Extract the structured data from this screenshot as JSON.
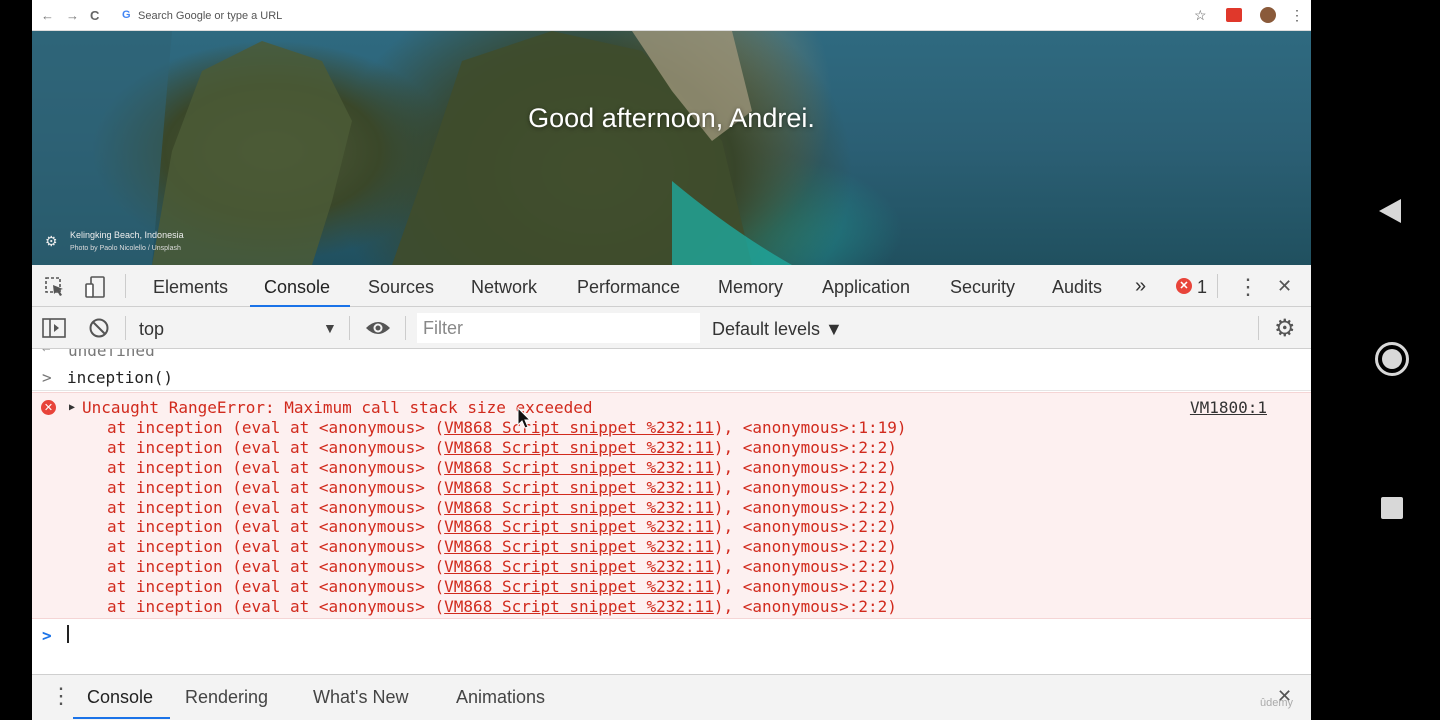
{
  "browser": {
    "omnibox_placeholder": "Search Google or type a URL",
    "back_icon": "←",
    "forward_icon": "→",
    "reload_icon": "C",
    "google_icon": "G",
    "star_icon": "☆",
    "menu_icon": "⋮"
  },
  "hero": {
    "greeting": "Good afternoon, Andrei.",
    "location": "Kelingking Beach, Indonesia",
    "credit": "Photo by Paolo Nicolello / Unsplash"
  },
  "devtools": {
    "tabs": [
      "Elements",
      "Console",
      "Sources",
      "Network",
      "Performance",
      "Memory",
      "Application",
      "Security",
      "Audits"
    ],
    "more_tabs": "»",
    "error_count": "1",
    "close": "✕",
    "context": "top",
    "filter_placeholder": "Filter",
    "levels": "Default levels ▼"
  },
  "console": {
    "previous_result": "undefined",
    "input_prompt": ">",
    "input": "inception()",
    "error": {
      "message": "Uncaught RangeError: Maximum call stack size exceeded",
      "source": "VM1800:1",
      "frames": [
        {
          "prefix": "at inception (eval at <anonymous> (",
          "link": "VM868 Script snippet %232:11",
          "suffix": "), <anonymous>:1:19)"
        },
        {
          "prefix": "at inception (eval at <anonymous> (",
          "link": "VM868 Script snippet %232:11",
          "suffix": "), <anonymous>:2:2)"
        },
        {
          "prefix": "at inception (eval at <anonymous> (",
          "link": "VM868 Script snippet %232:11",
          "suffix": "), <anonymous>:2:2)"
        },
        {
          "prefix": "at inception (eval at <anonymous> (",
          "link": "VM868 Script snippet %232:11",
          "suffix": "), <anonymous>:2:2)"
        },
        {
          "prefix": "at inception (eval at <anonymous> (",
          "link": "VM868 Script snippet %232:11",
          "suffix": "), <anonymous>:2:2)"
        },
        {
          "prefix": "at inception (eval at <anonymous> (",
          "link": "VM868 Script snippet %232:11",
          "suffix": "), <anonymous>:2:2)"
        },
        {
          "prefix": "at inception (eval at <anonymous> (",
          "link": "VM868 Script snippet %232:11",
          "suffix": "), <anonymous>:2:2)"
        },
        {
          "prefix": "at inception (eval at <anonymous> (",
          "link": "VM868 Script snippet %232:11",
          "suffix": "), <anonymous>:2:2)"
        },
        {
          "prefix": "at inception (eval at <anonymous> (",
          "link": "VM868 Script snippet %232:11",
          "suffix": "), <anonymous>:2:2)"
        },
        {
          "prefix": "at inception (eval at <anonymous> (",
          "link": "VM868 Script snippet %232:11",
          "suffix": "), <anonymous>:2:2)"
        }
      ]
    }
  },
  "drawer": {
    "tabs": [
      "Console",
      "Rendering",
      "What's New",
      "Animations"
    ],
    "menu": "⋮",
    "close": "✕"
  },
  "watermark": "ûdemy",
  "colors": {
    "error_text": "#d12a1d",
    "error_bg": "#fdf0f0",
    "accent": "#1a73e8"
  }
}
